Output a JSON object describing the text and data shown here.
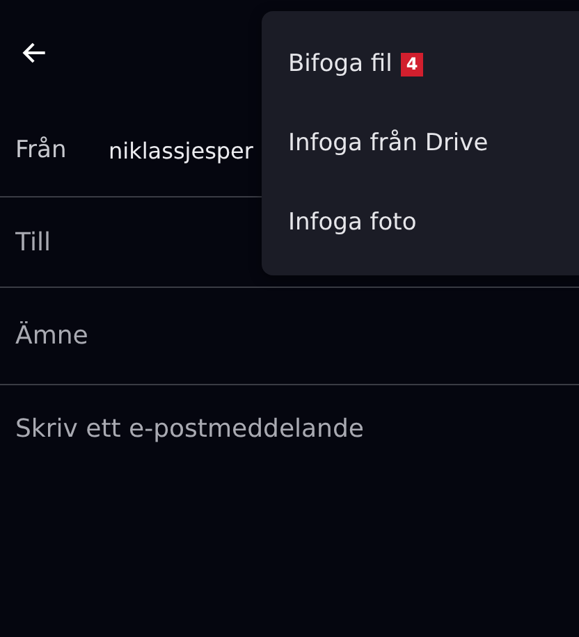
{
  "from": {
    "label": "Från",
    "value": "niklassjesper"
  },
  "to": {
    "placeholder": "Till"
  },
  "subject": {
    "placeholder": "Ämne"
  },
  "body": {
    "placeholder": "Skriv ett e-postmeddelande"
  },
  "menu": {
    "items": [
      {
        "label": "Bifoga fil",
        "badge": "4"
      },
      {
        "label": "Infoga från Drive"
      },
      {
        "label": "Infoga foto"
      }
    ]
  }
}
